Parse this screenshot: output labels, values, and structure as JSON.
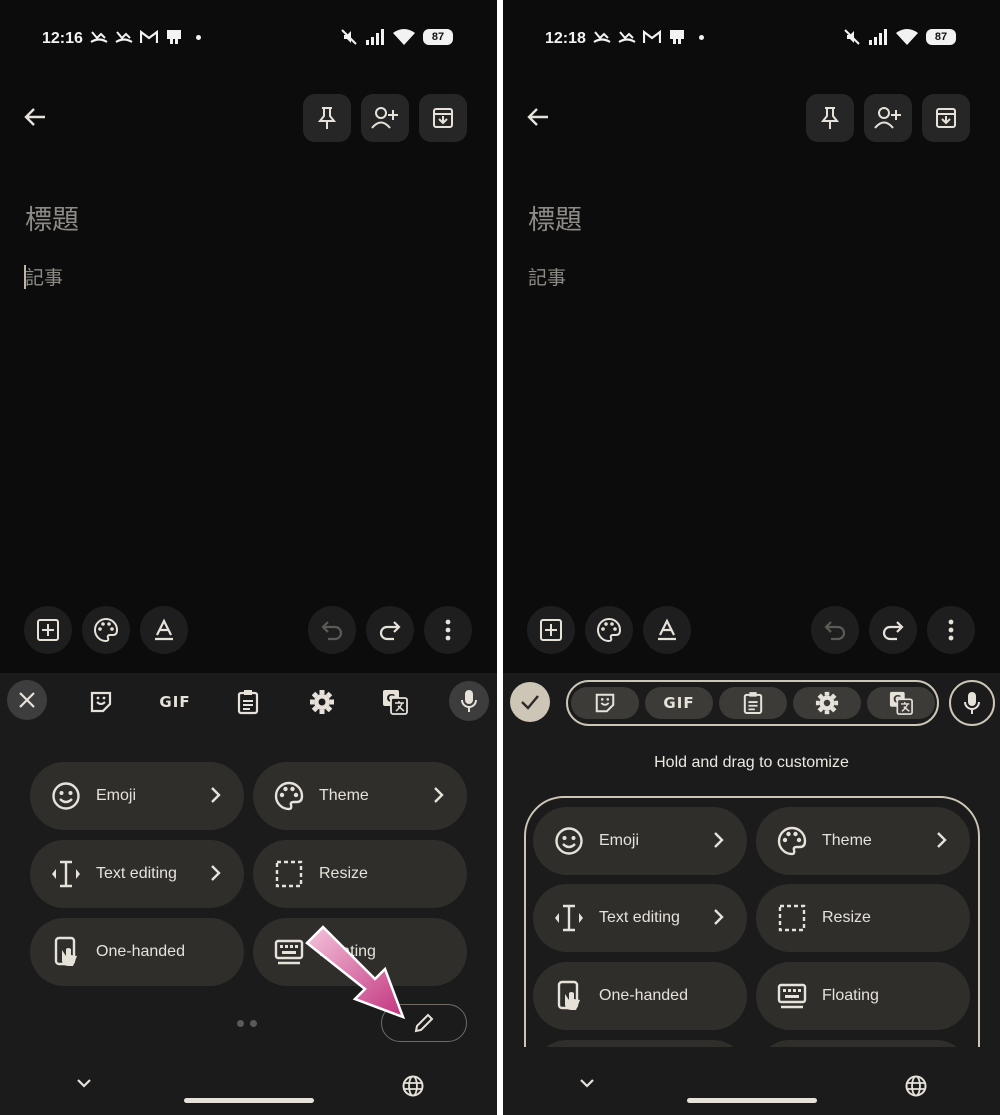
{
  "left": {
    "status": {
      "time": "12:16",
      "battery": "87"
    },
    "note": {
      "title_placeholder": "標題",
      "body_placeholder": "記事"
    },
    "toolbar": {
      "gif_label": "GIF"
    },
    "menu": {
      "emoji": "Emoji",
      "theme": "Theme",
      "text_editing": "Text editing",
      "resize": "Resize",
      "one_handed": "One-handed",
      "floating": "Floating"
    }
  },
  "right": {
    "status": {
      "time": "12:18",
      "battery": "87"
    },
    "note": {
      "title_placeholder": "標題",
      "body_placeholder": "記事"
    },
    "toolbar": {
      "gif_label": "GIF"
    },
    "hint": "Hold and drag to customize",
    "menu": {
      "emoji": "Emoji",
      "theme": "Theme",
      "text_editing": "Text editing",
      "resize": "Resize",
      "one_handed": "One-handed",
      "floating": "Floating"
    }
  },
  "colors": {
    "background": "#0c0c0c",
    "keyboard": "#1b1b1b",
    "chip": "#2f2e2b",
    "accent_outline": "#cdc6b6",
    "annotation_arrow": "#c2337e"
  },
  "icons": [
    "back-arrow-icon",
    "pin-icon",
    "add-person-icon",
    "archive-icon",
    "add-box-icon",
    "palette-icon",
    "text-format-icon",
    "undo-icon",
    "redo-icon",
    "more-vert-icon",
    "close-icon",
    "sticker-icon",
    "clipboard-icon",
    "settings-icon",
    "translate-icon",
    "mic-icon",
    "emoji-icon",
    "text-cursor-icon",
    "resize-icon",
    "one-handed-icon",
    "keyboard-icon",
    "pencil-icon",
    "chevron-down-icon",
    "globe-icon",
    "check-icon"
  ]
}
